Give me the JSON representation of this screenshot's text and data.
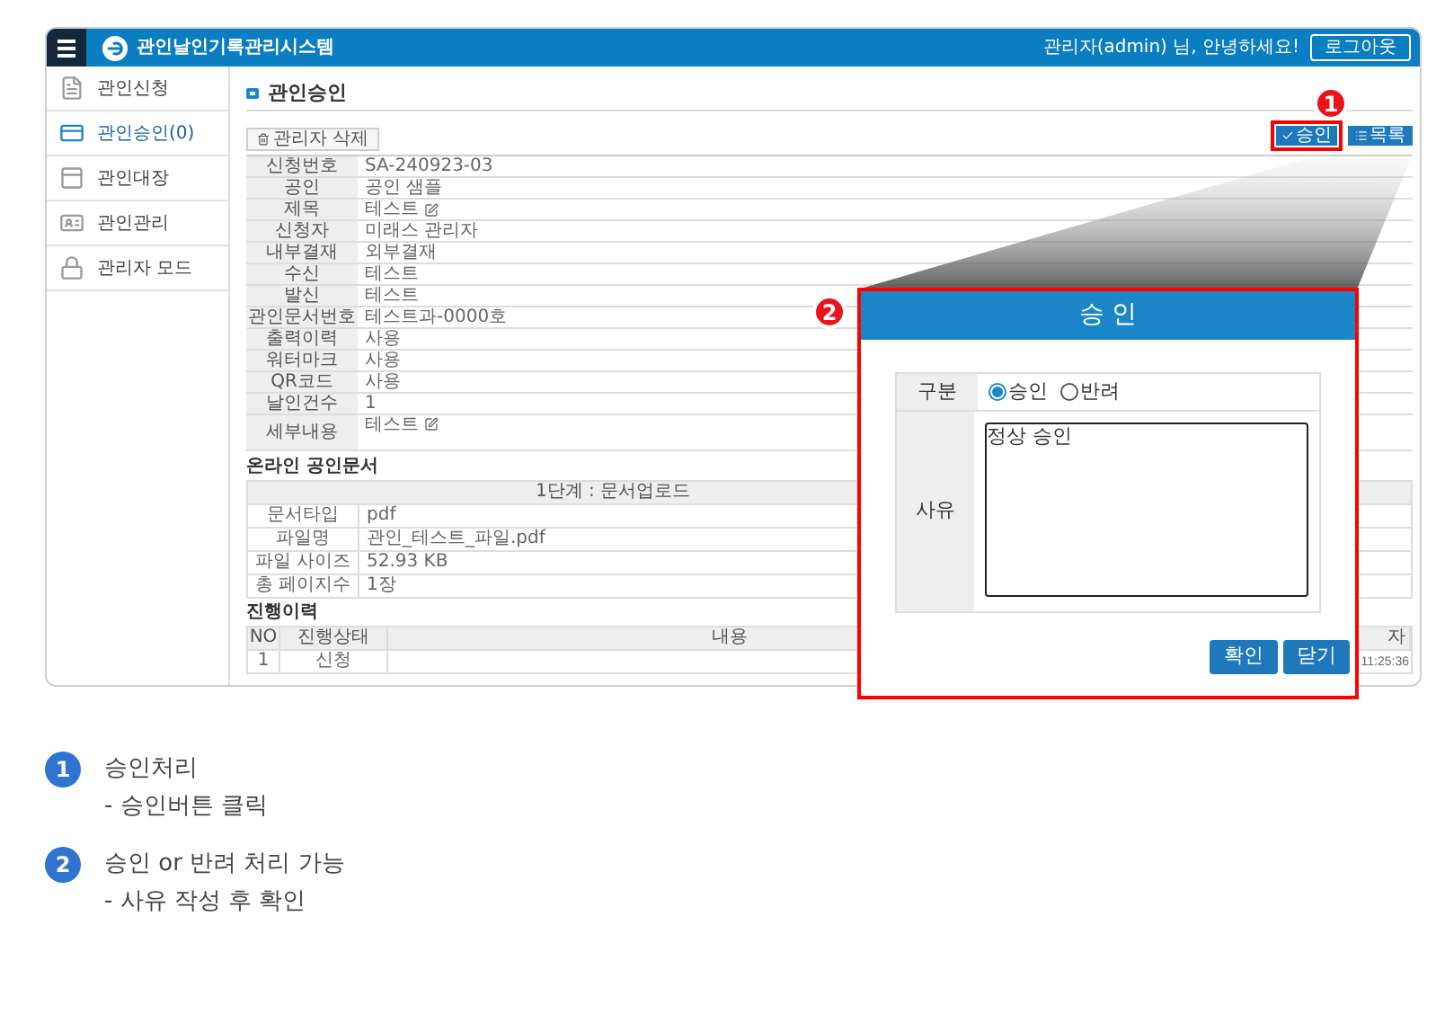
{
  "header": {
    "title": "관인날인기록관리시스템",
    "greeting": "관리자(admin) 님, 안녕하세요!",
    "logout": "로그아웃"
  },
  "sidebar": {
    "items": [
      {
        "label": "관인신청",
        "kind": "document",
        "selected": false
      },
      {
        "label": "관인승인(0)",
        "kind": "card",
        "selected": true
      },
      {
        "label": "관인대장",
        "kind": "ledger",
        "selected": false
      },
      {
        "label": "관인관리",
        "kind": "idcard",
        "selected": false
      },
      {
        "label": "관리자 모드",
        "kind": "lock",
        "selected": false
      }
    ]
  },
  "page": {
    "title": "관인승인",
    "delete_button": "관리자 삭제",
    "approve_button": "승인",
    "list_button": "목록"
  },
  "details": [
    {
      "label": "신청번호",
      "value": "SA-240923-03",
      "editable": false
    },
    {
      "label": "공인",
      "value": "공인 샘플",
      "editable": false
    },
    {
      "label": "제목",
      "value": "테스트",
      "editable": true
    },
    {
      "label": "신청자",
      "value": "미래스 관리자",
      "editable": false
    },
    {
      "label": "내부결재",
      "value": "외부결재",
      "editable": false
    },
    {
      "label": "수신",
      "value": "테스트",
      "editable": false
    },
    {
      "label": "발신",
      "value": "테스트",
      "editable": false
    },
    {
      "label": "관인문서번호",
      "value": "테스트과-0000호",
      "editable": false
    },
    {
      "label": "출력이력",
      "value": "사용",
      "editable": false
    },
    {
      "label": "워터마크",
      "value": "사용",
      "editable": false
    },
    {
      "label": "QR코드",
      "value": "사용",
      "editable": false
    },
    {
      "label": "날인건수",
      "value": "1",
      "editable": false
    },
    {
      "label": "세부내용",
      "value": "테스트",
      "editable": true
    }
  ],
  "online_doc": {
    "title": "온라인 공인문서",
    "stage": "1단계 : 문서업로드",
    "rows": [
      {
        "label": "문서타입",
        "value": "pdf"
      },
      {
        "label": "파일명",
        "value": "관인_테스트_파일.pdf"
      },
      {
        "label": "파일 사이즈",
        "value": "52.93 KB"
      },
      {
        "label": "총 페이지수",
        "value": "1장"
      }
    ]
  },
  "history": {
    "title": "진행이력",
    "columns": [
      "NO",
      "진행상태",
      "내용",
      "자"
    ],
    "rows": [
      {
        "no": "1",
        "status": "신청",
        "time": "11:25:36"
      }
    ]
  },
  "modal": {
    "title": "승 인",
    "type_label": "구분",
    "options": [
      {
        "label": "승인",
        "selected": true
      },
      {
        "label": "반려",
        "selected": false
      }
    ],
    "reason_label": "사유",
    "reason": "정상 승인",
    "confirm": "확인",
    "close": "닫기"
  },
  "callouts": [
    {
      "number": "1"
    },
    {
      "number": "2"
    }
  ],
  "legend": [
    {
      "number": "1",
      "title": "승인처리",
      "desc": "- 승인버튼 클릭"
    },
    {
      "number": "2",
      "title": "승인 or 반려 처리 가능",
      "desc": "- 사유 작성 후 확인"
    }
  ]
}
